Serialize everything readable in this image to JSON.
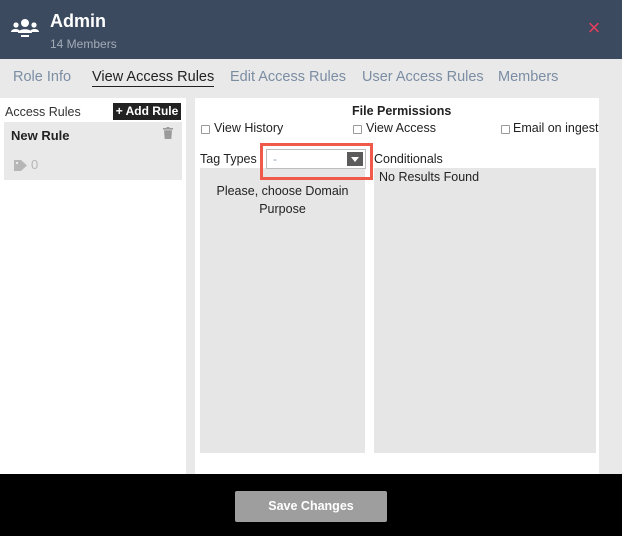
{
  "header": {
    "title": "Admin",
    "subtitle": "14 Members",
    "group_icon": "users-group-icon",
    "close_icon": "close-icon",
    "close_glyph": "×"
  },
  "tabs": [
    {
      "label": "Role Info",
      "active": false
    },
    {
      "label": "View Access Rules",
      "active": true
    },
    {
      "label": "Edit Access Rules",
      "active": false
    },
    {
      "label": "User Access Rules",
      "active": false
    },
    {
      "label": "Members",
      "active": false
    }
  ],
  "sidebar": {
    "heading": "Access Rules",
    "add_button": "+ Add Rule",
    "rules": [
      {
        "name": "New Rule",
        "tag_count": "0",
        "delete_icon": "trash-icon",
        "tag_icon": "tag-icon"
      }
    ]
  },
  "permissions": {
    "view_history": {
      "label": "View History",
      "checked": false
    },
    "file_permissions_heading": "File Permissions",
    "view_access": {
      "label": "View Access",
      "checked": false
    },
    "email_on_ingest": {
      "label": "Email on ingest",
      "checked": false
    }
  },
  "tag_types": {
    "label": "Tag Types",
    "selected": "-",
    "empty_message": "Please, choose Domain Purpose"
  },
  "conditionals": {
    "label": "Conditionals",
    "empty_message": "No Results Found"
  },
  "footer": {
    "save_label": "Save Changes"
  },
  "colors": {
    "header_bg": "#3b4a5e",
    "close_accent": "#e2405e",
    "tab_inactive": "#7b8da3",
    "highlight_border": "#ef5a4a",
    "save_button_bg": "#9e9e9e"
  }
}
